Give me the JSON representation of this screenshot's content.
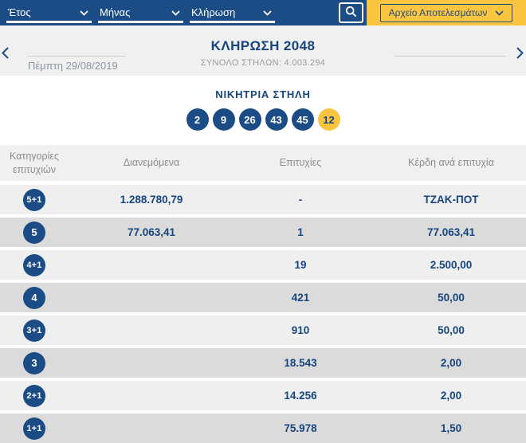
{
  "colors": {
    "brand_blue": "#1B4C86",
    "text_navy": "#17457E",
    "brand_yellow": "#FBC540",
    "row_light": "#EFEFF0",
    "row_dark": "#DBDBDC",
    "section_gray": "#F0F0F1"
  },
  "topbar": {
    "dropdowns": [
      {
        "label": "Έτος"
      },
      {
        "label": "Μήνας"
      },
      {
        "label": "Κλήρωση"
      }
    ],
    "search_icon": "magnifier",
    "archive_button": "Αρχείο Αποτελεσμάτων"
  },
  "draw_header": {
    "date": "Πέμπτη 29/08/2019",
    "title": "ΚΛΗΡΩΣΗ 2048",
    "subtitle": "ΣΥΝΟΛΟ ΣΤΗΛΩΝ: 4.003.294"
  },
  "winning_column": {
    "label": "ΝΙΚΗΤΡΙΑ ΣΤΗΛΗ",
    "numbers": [
      "2",
      "9",
      "26",
      "43",
      "45"
    ],
    "joker": "12"
  },
  "results_table": {
    "headers": {
      "categories": "Κατηγορίες επιτυχιών",
      "distributed": "Διανεμόμενα",
      "wins": "Επιτυχίες",
      "prize_per_win": "Κέρδη ανά επιτυχία"
    },
    "rows": [
      {
        "category": "5+1",
        "distributed": "1.288.780,79",
        "wins": "-",
        "prize": "ΤΖΑΚ-ΠΟΤ"
      },
      {
        "category": "5",
        "distributed": "77.063,41",
        "wins": "1",
        "prize": "77.063,41"
      },
      {
        "category": "4+1",
        "distributed": "",
        "wins": "19",
        "prize": "2.500,00"
      },
      {
        "category": "4",
        "distributed": "",
        "wins": "421",
        "prize": "50,00"
      },
      {
        "category": "3+1",
        "distributed": "",
        "wins": "910",
        "prize": "50,00"
      },
      {
        "category": "3",
        "distributed": "",
        "wins": "18.543",
        "prize": "2,00"
      },
      {
        "category": "2+1",
        "distributed": "",
        "wins": "14.256",
        "prize": "2,00"
      },
      {
        "category": "1+1",
        "distributed": "",
        "wins": "75.978",
        "prize": "1,50"
      }
    ]
  }
}
